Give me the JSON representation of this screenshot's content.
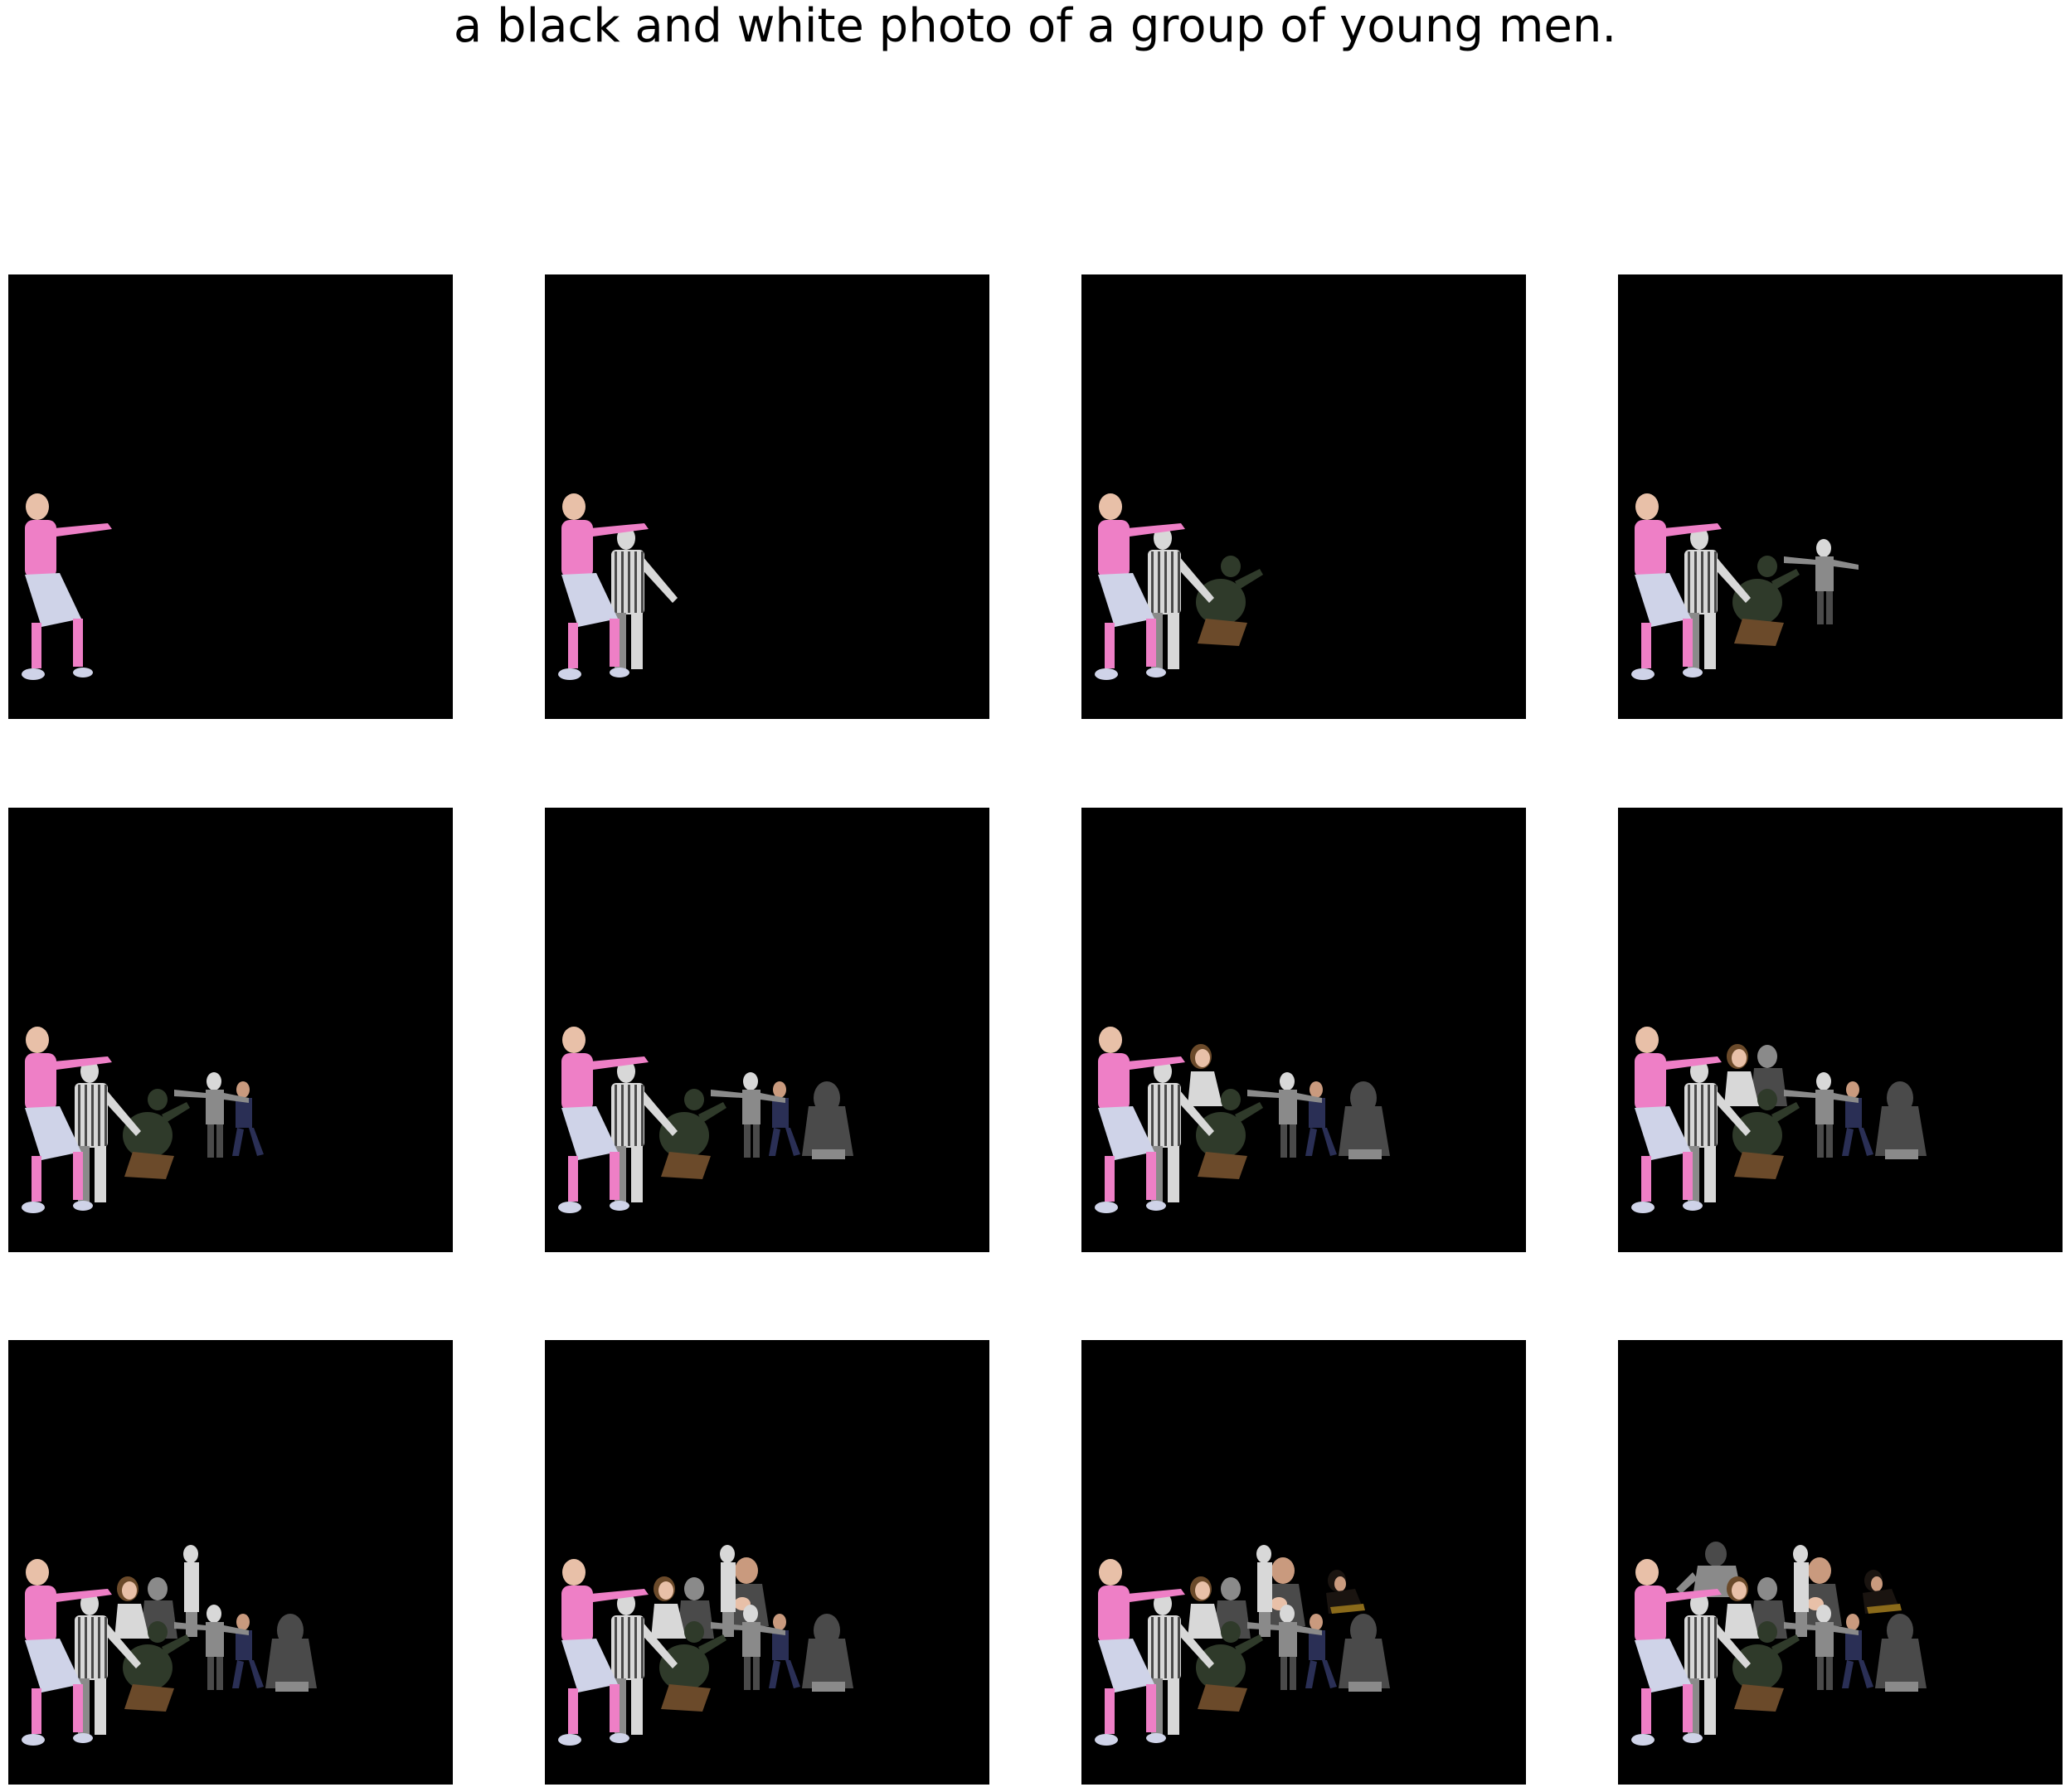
{
  "caption": "a black and white photo of a group of young men.",
  "colors": {
    "page_background": "#ffffff",
    "panel_background": "#000000",
    "pink_shirt": "#ee7fc6",
    "light_shorts": "#cfd3e8",
    "white_gray": "#d8d8d8",
    "mid_gray": "#8a8a8a",
    "dark_gray": "#4a4a4a",
    "dark_green": "#2f3a2a",
    "brown": "#6b4a2a",
    "navy": "#2a2f55",
    "skin": "#c99a7e",
    "skin_light": "#e8c0a8"
  },
  "panels": [
    {
      "step": 1,
      "figures": 1
    },
    {
      "step": 2,
      "figures": 2
    },
    {
      "step": 3,
      "figures": 3
    },
    {
      "step": 4,
      "figures": 4
    },
    {
      "step": 5,
      "figures": 5
    },
    {
      "step": 6,
      "figures": 6
    },
    {
      "step": 7,
      "figures": 7
    },
    {
      "step": 8,
      "figures": 8
    },
    {
      "step": 9,
      "figures": 9
    },
    {
      "step": 10,
      "figures": 10
    },
    {
      "step": 11,
      "figures": 11
    },
    {
      "step": 12,
      "figures": 12
    }
  ]
}
